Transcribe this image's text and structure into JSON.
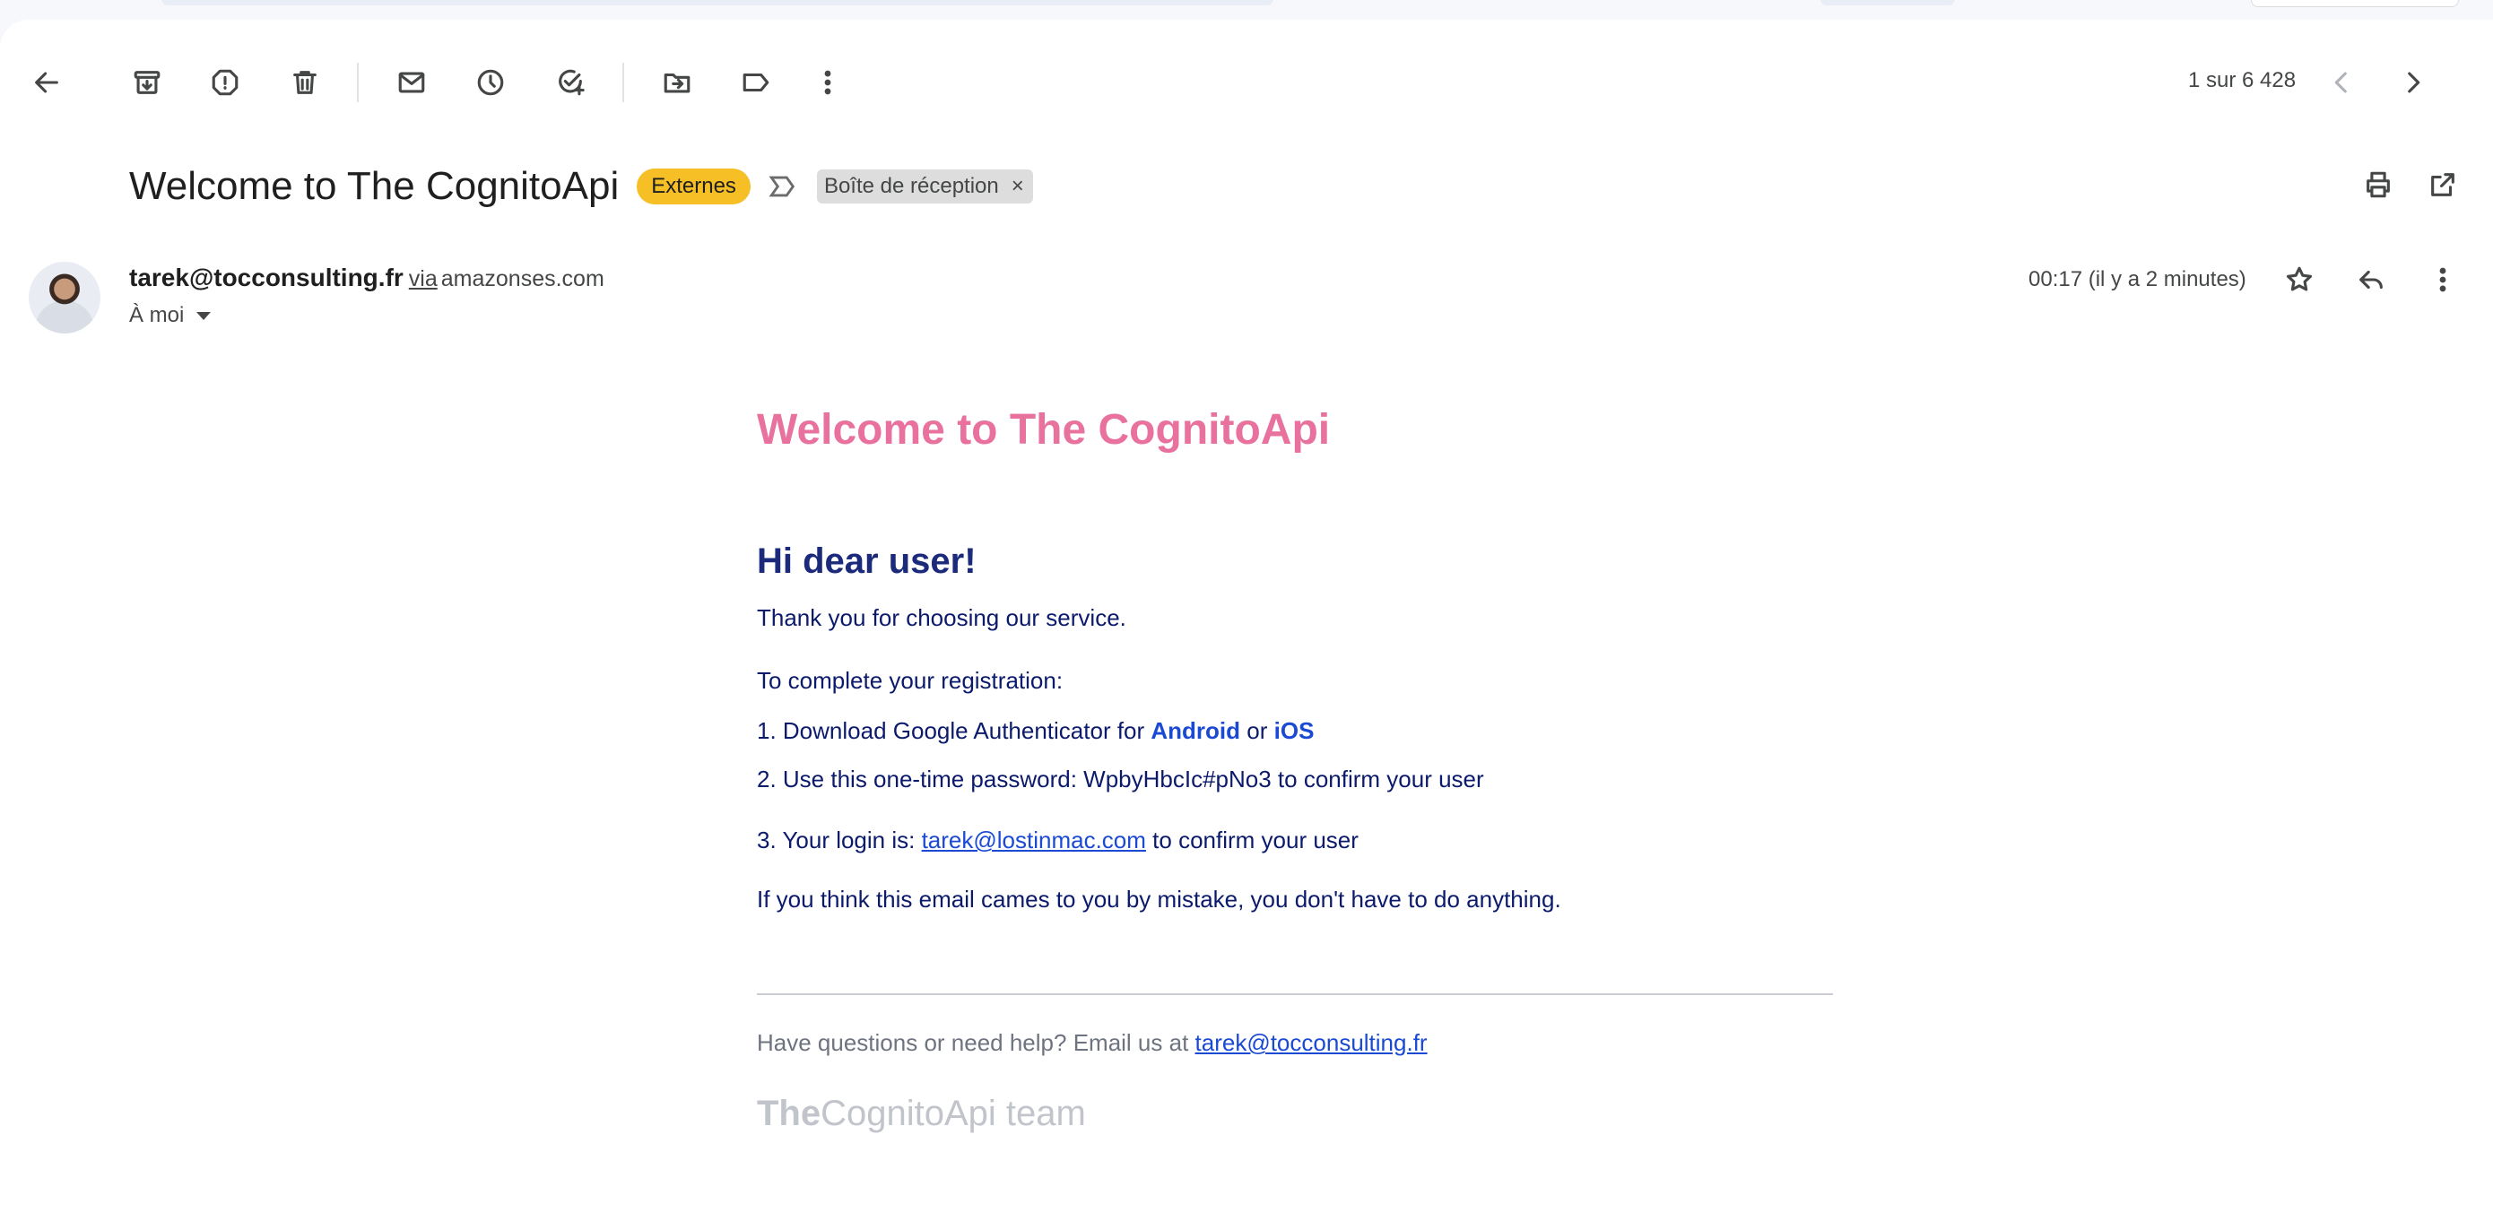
{
  "toolbar": {
    "pager_text": "1 sur 6 428",
    "icons": [
      "back-arrow-icon",
      "archive-icon",
      "report-spam-icon",
      "delete-icon",
      "mark-unread-icon",
      "snooze-icon",
      "add-to-tasks-icon",
      "move-to-icon",
      "label-icon",
      "more-vert-icon",
      "older-chevron-icon",
      "newer-chevron-icon"
    ]
  },
  "subject": {
    "title": "Welcome to The CognitoApi",
    "badge": "Externes",
    "label_chip": "Boîte de réception",
    "remove_label": "×",
    "badge_color": "#f6bf26"
  },
  "sender": {
    "email": "tarek@tocconsulting.fr",
    "via": "via",
    "domain": "amazonses.com",
    "recipient": "À moi",
    "time": "00:17 (il y a 2 minutes)"
  },
  "message": {
    "title": "Welcome to The CognitoApi",
    "greeting": "Hi dear user!",
    "thanks": "Thank you for choosing our service.",
    "complete": "To complete your registration:",
    "step1_prefix": "1. Download Google Authenticator for ",
    "step1_android": "Android",
    "step1_or": " or ",
    "step1_ios": "iOS",
    "step2": "2. Use this one-time password: WpbyHbcIc#pNo3 to confirm your user",
    "step3_prefix": "3. Your login is: ",
    "step3_email": "tarek@lostinmac.com",
    "step3_suffix": " to confirm your user",
    "mistake": "If you think this email cames to you by mistake, you don't have to do anything.",
    "help_prefix": "Have questions or need help? Email us at ",
    "help_email": "tarek@tocconsulting.fr",
    "sign_bold": "The",
    "sign_rest": "CognitoApi team",
    "title_color": "#e8719e",
    "text_color": "#0b1a6b",
    "link_color": "#1a49d4"
  }
}
